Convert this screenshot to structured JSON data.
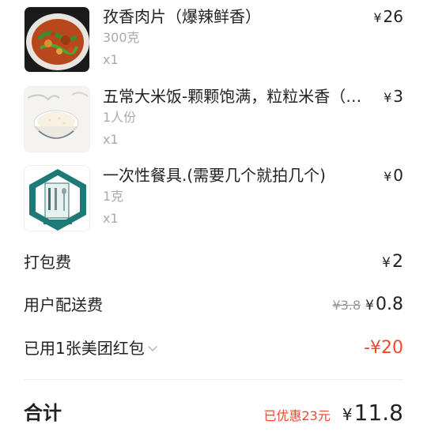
{
  "currency": "¥",
  "items": [
    {
      "name": "孜香肉片（爆辣鲜香）",
      "spec": "300克",
      "qty": "x1",
      "price": "26",
      "image_icon": "stir-fry-dish-icon"
    },
    {
      "name": "五常大米饭-颗颗饱满，粒粒米香（2...",
      "spec": "1人份",
      "qty": "x1",
      "price": "3",
      "image_icon": "rice-bowl-icon"
    },
    {
      "name": "一次性餐具.(需要几个就拍几个)",
      "spec": "1克",
      "qty": "x1",
      "price": "0",
      "image_icon": "tableware-package-icon"
    }
  ],
  "fees": {
    "packing_label": "打包费",
    "packing_value": "2",
    "delivery_label": "用户配送费",
    "delivery_original": "¥3.8",
    "delivery_value": "0.8",
    "coupon_label": "已用1张美团红包",
    "coupon_value": "-¥20"
  },
  "total": {
    "label": "合计",
    "discount_text": "已优惠23元",
    "value": "11.8"
  },
  "colors": {
    "accent_red": "#f0472e",
    "text": "#222222",
    "muted": "#aaaaaa"
  }
}
